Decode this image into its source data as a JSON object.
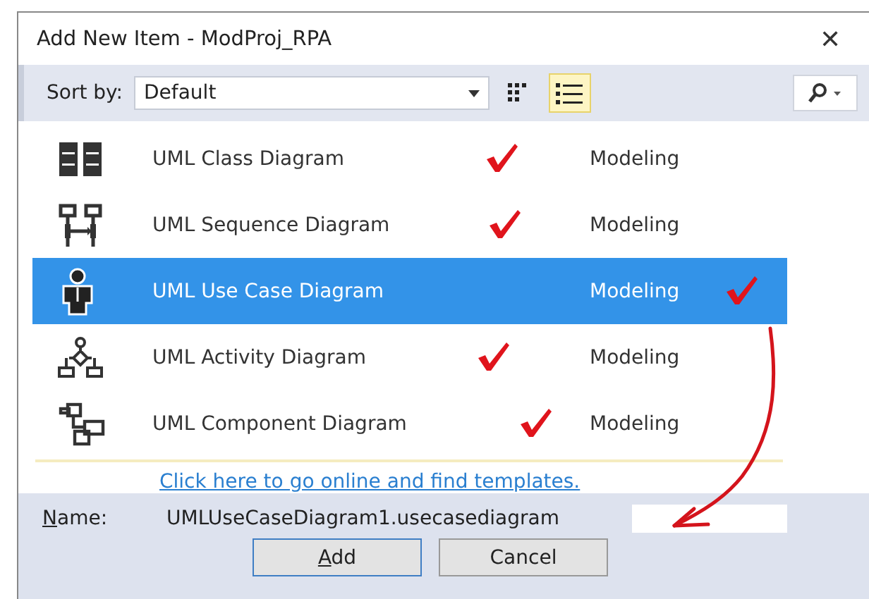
{
  "window": {
    "title": "Add New Item - ModProj_RPA",
    "close": "✕"
  },
  "toolbar": {
    "sort_label": "Sort by:",
    "sort_value": "Default",
    "views": [
      {
        "kind": "grid",
        "selected": false
      },
      {
        "kind": "list",
        "selected": true
      }
    ]
  },
  "items": [
    {
      "name": "UML Class Diagram",
      "category": "Modeling",
      "selected": false
    },
    {
      "name": "UML Sequence Diagram",
      "category": "Modeling",
      "selected": false
    },
    {
      "name": "UML Use Case Diagram",
      "category": "Modeling",
      "selected": true
    },
    {
      "name": "UML Activity Diagram",
      "category": "Modeling",
      "selected": false
    },
    {
      "name": "UML Component Diagram",
      "category": "Modeling",
      "selected": false
    }
  ],
  "online_link": "Click here to go online and find templates.",
  "name_field": {
    "label": "Name:",
    "value": "UMLUseCaseDiagram1.usecasediagram"
  },
  "buttons": [
    "Add",
    "Cancel"
  ]
}
